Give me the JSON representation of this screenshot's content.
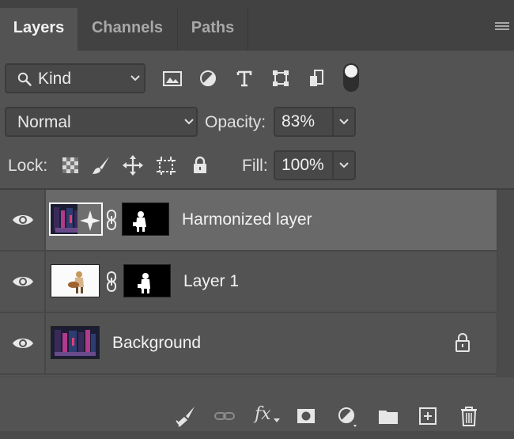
{
  "tabs": [
    {
      "label": "Layers",
      "active": true
    },
    {
      "label": "Channels",
      "active": false
    },
    {
      "label": "Paths",
      "active": false
    }
  ],
  "panel_menu_icon": "hamburger-menu-icon",
  "filter": {
    "kind_label": "Kind",
    "search_icon": "search-icon",
    "type_icons": [
      "image-filter-icon",
      "adjustment-filter-icon",
      "type-filter-icon",
      "shape-filter-icon",
      "smart-object-filter-icon"
    ],
    "toggle": "filter-toggle"
  },
  "blend": {
    "mode": "Normal",
    "opacity_label": "Opacity:",
    "opacity_value": "83%"
  },
  "lock": {
    "label": "Lock:",
    "icons": [
      "lock-transparent-pixels-icon",
      "lock-image-pixels-icon",
      "lock-position-icon",
      "lock-artboard-icon",
      "lock-all-icon"
    ],
    "fill_label": "Fill:",
    "fill_value": "100%"
  },
  "layers": [
    {
      "name": "Harmonized layer",
      "selected": true,
      "visible": true,
      "has_mask": true,
      "locked": false
    },
    {
      "name": "Layer 1",
      "selected": false,
      "visible": true,
      "has_mask": true,
      "locked": false
    },
    {
      "name": "Background",
      "selected": false,
      "visible": true,
      "has_mask": false,
      "locked": true
    }
  ],
  "bottom_toolbar": {
    "fx_label": "fx",
    "icons": [
      "brush-cleanup-icon",
      "link-layers-icon",
      "layer-style-icon",
      "add-mask-icon",
      "adjustment-layer-icon",
      "new-group-icon",
      "new-layer-icon",
      "delete-layer-icon"
    ]
  },
  "colors": {
    "panel": "#535353",
    "tabbar": "#424242",
    "selected_row": "#696969",
    "text": "#f2f2f2"
  }
}
